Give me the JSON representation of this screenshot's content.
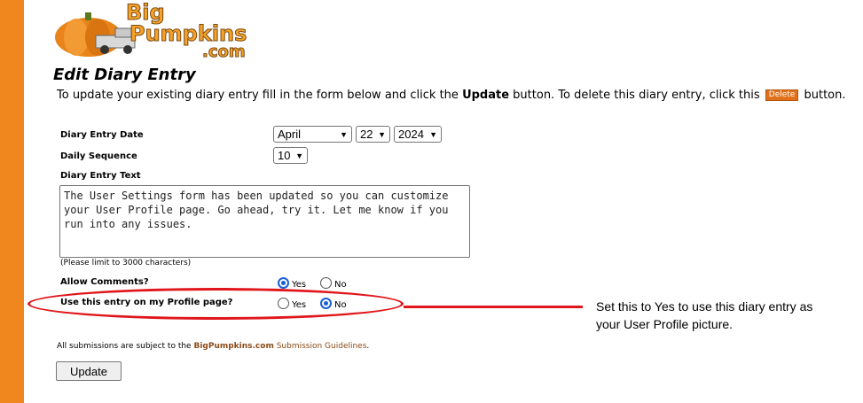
{
  "logo": {
    "line1": "Big",
    "line2": "Pumpkins",
    "line3": ".com"
  },
  "page": {
    "title": "Edit Diary Entry",
    "intro_before": "To update your existing diary entry fill in the form below and click the ",
    "intro_bold": "Update",
    "intro_middle": " button. To delete this diary entry, click this ",
    "delete_label": "Delete",
    "intro_after": " button."
  },
  "form": {
    "date_label": "Diary Entry Date",
    "month": "April",
    "day": "22",
    "year": "2024",
    "sequence_label": "Daily Sequence",
    "sequence": "10",
    "text_label": "Diary Entry Text",
    "text": "The User Settings form has been updated so you can customize your User Profile page. Go ahead, try it. Let me know if you run into any issues.",
    "text_hint": "(Please limit to 3000 characters)",
    "comments_label": "Allow Comments?",
    "comments_value": "Yes",
    "profile_label": "Use this entry on my Profile page?",
    "profile_value": "No",
    "yes_label": "Yes",
    "no_label": "No",
    "disclaimer_before": "All submissions are subject to the ",
    "disclaimer_brand": "BigPumpkins.com",
    "disclaimer_link": " Submission Guidelines",
    "disclaimer_after": ".",
    "update_label": "Update"
  },
  "annotation": {
    "line1": "Set this to Yes to use this diary entry as",
    "line2": "your User Profile picture.",
    "color": "#e0161b"
  },
  "colors": {
    "stripe": "#f0861e",
    "radio_selected": "#1a5ed8"
  }
}
